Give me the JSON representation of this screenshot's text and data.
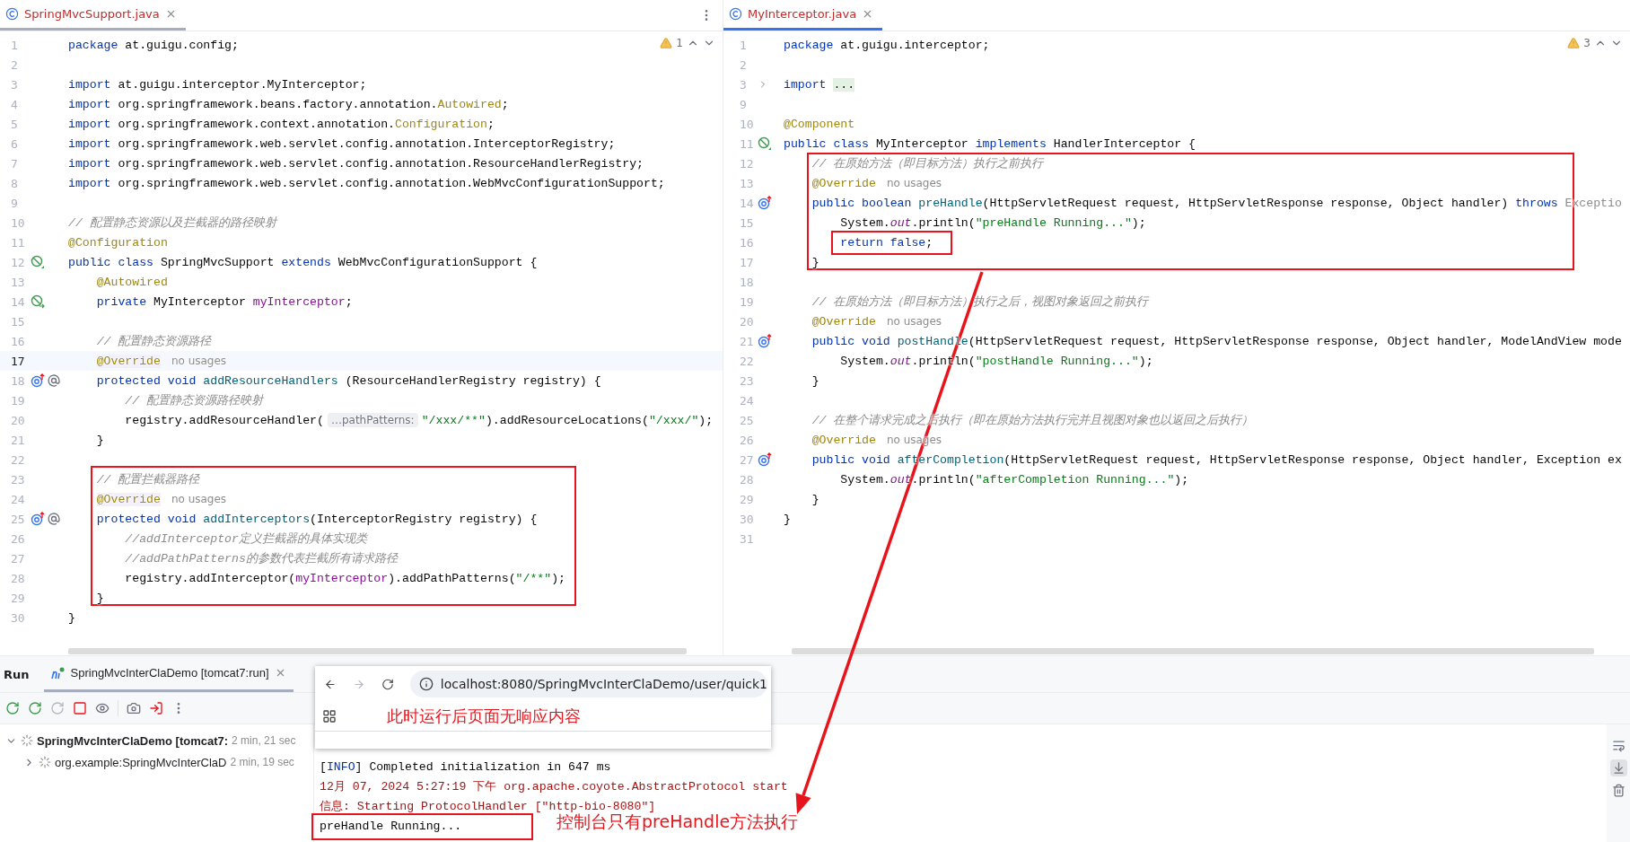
{
  "editors": [
    {
      "tabs": [
        {
          "label": "SpringMvcSupport.java",
          "selected": false
        }
      ],
      "warnings": "1",
      "menu": true,
      "lines": [
        {
          "n": "1",
          "current": false,
          "tokens": [
            {
              "kind": "kw",
              "text": "package"
            },
            {
              "kind": "p",
              "text": " at.guigu.config;"
            }
          ]
        },
        {
          "n": "2",
          "current": false
        },
        {
          "n": "3",
          "current": false,
          "tokens": [
            {
              "kind": "kw",
              "text": "import"
            },
            {
              "kind": "p",
              "text": " at.guigu.interceptor.MyInterceptor;"
            }
          ]
        },
        {
          "n": "4",
          "current": false,
          "tokens": [
            {
              "kind": "kw",
              "text": "import"
            },
            {
              "kind": "p",
              "text": " org.springframework.beans.factory.annotation."
            },
            {
              "kind": "ann",
              "text": "Autowired"
            },
            {
              "kind": "p",
              "text": ";"
            }
          ]
        },
        {
          "n": "5",
          "current": false,
          "tokens": [
            {
              "kind": "kw",
              "text": "import"
            },
            {
              "kind": "p",
              "text": " org.springframework.context.annotation."
            },
            {
              "kind": "ann",
              "text": "Configuration"
            },
            {
              "kind": "p",
              "text": ";"
            }
          ]
        },
        {
          "n": "6",
          "current": false,
          "tokens": [
            {
              "kind": "kw",
              "text": "import"
            },
            {
              "kind": "p",
              "text": " org.springframework.web.servlet.config.annotation.InterceptorRegistry;"
            }
          ]
        },
        {
          "n": "7",
          "current": false,
          "tokens": [
            {
              "kind": "kw",
              "text": "import"
            },
            {
              "kind": "p",
              "text": " org.springframework.web.servlet.config.annotation.ResourceHandlerRegistry;"
            }
          ]
        },
        {
          "n": "8",
          "current": false,
          "tokens": [
            {
              "kind": "kw",
              "text": "import"
            },
            {
              "kind": "p",
              "text": " org.springframework.web.servlet.config.annotation.WebMvcConfigurationSupport;"
            }
          ]
        },
        {
          "n": "9",
          "current": false
        },
        {
          "n": "10",
          "current": false,
          "tokens": [
            {
              "kind": "cm",
              "text": "// 配置静态资源以及拦截器的路径映射"
            }
          ]
        },
        {
          "n": "11",
          "current": false,
          "tokens": [
            {
              "kind": "ann",
              "text": "@Configuration"
            }
          ]
        },
        {
          "n": "12",
          "current": false,
          "gutter": [
            {
              "kind": "bean"
            }
          ],
          "tokens": [
            {
              "kind": "kw",
              "text": "public class"
            },
            {
              "kind": "p",
              "text": " SpringMvcSupport "
            },
            {
              "kind": "kw",
              "text": "extends"
            },
            {
              "kind": "p",
              "text": " WebMvcConfigurationSupport {"
            }
          ]
        },
        {
          "n": "13",
          "current": false,
          "tokens": [
            {
              "kind": "ann",
              "text": "    @Autowired"
            }
          ]
        },
        {
          "n": "14",
          "current": false,
          "gutter": [
            {
              "kind": "bean-link"
            }
          ],
          "tokens": [
            {
              "kind": "kw",
              "text": "    private"
            },
            {
              "kind": "p",
              "text": " MyInterceptor "
            },
            {
              "kind": "fld",
              "text": "myInterceptor"
            },
            {
              "kind": "p",
              "text": ";"
            }
          ]
        },
        {
          "n": "15",
          "current": false
        },
        {
          "n": "16",
          "current": false,
          "tokens": [
            {
              "kind": "cm",
              "text": "    // 配置静态资源路径"
            }
          ]
        },
        {
          "n": "17",
          "current": true,
          "tokens": [
            {
              "kind": "annbg",
              "text": "    @Override"
            },
            {
              "kind": "hint",
              "text": "no usages"
            }
          ]
        },
        {
          "n": "18",
          "current": false,
          "gutter": [
            {
              "kind": "override"
            },
            {
              "kind": "at"
            }
          ],
          "tokens": [
            {
              "kind": "kw",
              "text": "    protected void"
            },
            {
              "kind": "fn",
              "text": " addResourceHandlers"
            },
            {
              "kind": "p",
              "text": " (ResourceHandlerRegistry registry) {"
            }
          ]
        },
        {
          "n": "19",
          "current": false,
          "tokens": [
            {
              "kind": "cm",
              "text": "        // 配置静态资源路径映射"
            }
          ]
        },
        {
          "n": "20",
          "current": false,
          "tokens": [
            {
              "kind": "p",
              "text": "        registry.addResourceHandler("
            },
            {
              "kind": "pill",
              "text": "…pathPatterns:"
            },
            {
              "kind": "str",
              "text": "\"/xxx/**\""
            },
            {
              "kind": "p",
              "text": ").addResourceLocations("
            },
            {
              "kind": "str",
              "text": "\"/xxx/\""
            },
            {
              "kind": "p",
              "text": ");"
            }
          ]
        },
        {
          "n": "21",
          "current": false,
          "tokens": [
            {
              "kind": "p",
              "text": "    }"
            }
          ]
        },
        {
          "n": "22",
          "current": false
        },
        {
          "n": "23",
          "current": false,
          "tokens": [
            {
              "kind": "cm",
              "text": "    // 配置拦截器路径"
            }
          ]
        },
        {
          "n": "24",
          "current": false,
          "tokens": [
            {
              "kind": "annbg",
              "text": "    @Override"
            },
            {
              "kind": "hint",
              "text": "no usages"
            }
          ]
        },
        {
          "n": "25",
          "current": false,
          "gutter": [
            {
              "kind": "override"
            },
            {
              "kind": "at"
            }
          ],
          "tokens": [
            {
              "kind": "kw",
              "text": "    protected void"
            },
            {
              "kind": "fn",
              "text": " addInterceptors"
            },
            {
              "kind": "p",
              "text": "(InterceptorRegistry registry) {"
            }
          ]
        },
        {
          "n": "26",
          "current": false,
          "tokens": [
            {
              "kind": "cm",
              "text": "        //addInterceptor定义拦截器的具体实现类"
            }
          ]
        },
        {
          "n": "27",
          "current": false,
          "tokens": [
            {
              "kind": "cm",
              "text": "        //addPathPatterns的参数代表拦截所有请求路径"
            }
          ]
        },
        {
          "n": "28",
          "current": false,
          "tokens": [
            {
              "kind": "p",
              "text": "        registry.addInterceptor("
            },
            {
              "kind": "fld",
              "text": "myInterceptor"
            },
            {
              "kind": "p",
              "text": ").addPathPatterns("
            },
            {
              "kind": "str",
              "text": "\"/**\""
            },
            {
              "kind": "p",
              "text": ");"
            }
          ]
        },
        {
          "n": "29",
          "current": false,
          "tokens": [
            {
              "kind": "p",
              "text": "    }"
            }
          ]
        },
        {
          "n": "30",
          "current": false,
          "tokens": [
            {
              "kind": "p",
              "text": "}"
            }
          ]
        }
      ]
    },
    {
      "tabs": [
        {
          "label": "MyInterceptor.java",
          "selected": true
        }
      ],
      "warnings": "3",
      "menu": false,
      "lines": [
        {
          "n": "1",
          "current": false,
          "tokens": [
            {
              "kind": "kw",
              "text": "package"
            },
            {
              "kind": "p",
              "text": " at.guigu.interceptor;"
            }
          ]
        },
        {
          "n": "2",
          "current": false
        },
        {
          "n": "3",
          "current": false,
          "gutter": [
            {
              "kind": "fold"
            }
          ],
          "tokens": [
            {
              "kind": "kw",
              "text": "import "
            },
            {
              "kind": "fold",
              "text": "..."
            }
          ]
        },
        {
          "n": "9",
          "current": false
        },
        {
          "n": "10",
          "current": false,
          "tokens": [
            {
              "kind": "ann",
              "text": "@Component"
            }
          ]
        },
        {
          "n": "11",
          "current": false,
          "gutter": [
            {
              "kind": "bean"
            }
          ],
          "tokens": [
            {
              "kind": "kw",
              "text": "public class"
            },
            {
              "kind": "p",
              "text": " MyInterceptor "
            },
            {
              "kind": "kw",
              "text": "implements"
            },
            {
              "kind": "p",
              "text": " HandlerInterceptor {"
            }
          ]
        },
        {
          "n": "12",
          "current": false,
          "tokens": [
            {
              "kind": "cm",
              "text": "    // 在原始方法（即目标方法）执行之前执行"
            }
          ]
        },
        {
          "n": "13",
          "current": false,
          "tokens": [
            {
              "kind": "ann",
              "text": "    @Override"
            },
            {
              "kind": "hint",
              "text": "no usages"
            }
          ]
        },
        {
          "n": "14",
          "current": false,
          "gutter": [
            {
              "kind": "override"
            }
          ],
          "tokens": [
            {
              "kind": "kw",
              "text": "    public boolean"
            },
            {
              "kind": "fn",
              "text": " preHandle"
            },
            {
              "kind": "p",
              "text": "(HttpServletRequest request, HttpServletResponse response, Object handler) "
            },
            {
              "kind": "kw",
              "text": "throws"
            },
            {
              "kind": "dim",
              "text": " Exceptio"
            }
          ]
        },
        {
          "n": "15",
          "current": false,
          "tokens": [
            {
              "kind": "p",
              "text": "        System."
            },
            {
              "kind": "st",
              "text": "out"
            },
            {
              "kind": "p",
              "text": ".println("
            },
            {
              "kind": "str",
              "text": "\"preHandle Running...\""
            },
            {
              "kind": "p",
              "text": ");"
            }
          ]
        },
        {
          "n": "16",
          "current": false,
          "tokens": [
            {
              "kind": "kw",
              "text": "        return false"
            },
            {
              "kind": "p",
              "text": ";"
            }
          ]
        },
        {
          "n": "17",
          "current": false,
          "tokens": [
            {
              "kind": "p",
              "text": "    }"
            }
          ]
        },
        {
          "n": "18",
          "current": false
        },
        {
          "n": "19",
          "current": false,
          "tokens": [
            {
              "kind": "cm",
              "text": "    // 在原始方法（即目标方法）执行之后，视图对象返回之前执行"
            }
          ]
        },
        {
          "n": "20",
          "current": false,
          "tokens": [
            {
              "kind": "ann",
              "text": "    @Override"
            },
            {
              "kind": "hint",
              "text": "no usages"
            }
          ]
        },
        {
          "n": "21",
          "current": false,
          "gutter": [
            {
              "kind": "override"
            }
          ],
          "tokens": [
            {
              "kind": "kw",
              "text": "    public void"
            },
            {
              "kind": "fn",
              "text": " postHandle"
            },
            {
              "kind": "p",
              "text": "(HttpServletRequest request, HttpServletResponse response, Object handler, ModelAndView mode"
            }
          ]
        },
        {
          "n": "22",
          "current": false,
          "tokens": [
            {
              "kind": "p",
              "text": "        System."
            },
            {
              "kind": "st",
              "text": "out"
            },
            {
              "kind": "p",
              "text": ".println("
            },
            {
              "kind": "str",
              "text": "\"postHandle Running...\""
            },
            {
              "kind": "p",
              "text": ");"
            }
          ]
        },
        {
          "n": "23",
          "current": false,
          "tokens": [
            {
              "kind": "p",
              "text": "    }"
            }
          ]
        },
        {
          "n": "24",
          "current": false
        },
        {
          "n": "25",
          "current": false,
          "tokens": [
            {
              "kind": "cm",
              "text": "    // 在整个请求完成之后执行（即在原始方法执行完并且视图对象也以返回之后执行）"
            }
          ]
        },
        {
          "n": "26",
          "current": false,
          "tokens": [
            {
              "kind": "ann",
              "text": "    @Override"
            },
            {
              "kind": "hint",
              "text": "no usages"
            }
          ]
        },
        {
          "n": "27",
          "current": false,
          "gutter": [
            {
              "kind": "override"
            }
          ],
          "tokens": [
            {
              "kind": "kw",
              "text": "    public void"
            },
            {
              "kind": "fn",
              "text": " afterCompletion"
            },
            {
              "kind": "p",
              "text": "(HttpServletRequest request, HttpServletResponse response, Object handler, Exception ex"
            }
          ]
        },
        {
          "n": "28",
          "current": false,
          "tokens": [
            {
              "kind": "p",
              "text": "        System."
            },
            {
              "kind": "st",
              "text": "out"
            },
            {
              "kind": "p",
              "text": ".println("
            },
            {
              "kind": "str",
              "text": "\"afterCompletion Running...\""
            },
            {
              "kind": "p",
              "text": ");"
            }
          ]
        },
        {
          "n": "29",
          "current": false,
          "tokens": [
            {
              "kind": "p",
              "text": "    }"
            }
          ]
        },
        {
          "n": "30",
          "current": false,
          "tokens": [
            {
              "kind": "p",
              "text": "}"
            }
          ]
        },
        {
          "n": "31",
          "current": false
        }
      ]
    }
  ],
  "run_panel": {
    "title": "Run",
    "tabs": [
      {
        "label": "SpringMvcInterClaDemo [tomcat7:run]",
        "selected": true
      }
    ],
    "toolbar": [
      {
        "kind": "rerun",
        "disabled": false
      },
      {
        "kind": "rerun-tests",
        "disabled": false
      },
      {
        "kind": "restart",
        "disabled": true
      },
      {
        "kind": "stop",
        "disabled": false
      },
      {
        "kind": "watch",
        "disabled": false
      },
      {
        "kind": "screenshot",
        "disabled": false
      },
      {
        "kind": "exit",
        "disabled": false
      },
      {
        "kind": "more",
        "disabled": false
      }
    ],
    "tree": [
      {
        "label": "SpringMvcInterClaDemo [tomcat7:",
        "time": "2 min, 21 sec",
        "expanded": true,
        "children": [
          {
            "label": "org.example:SpringMvcInterClaD",
            "time": "2 min, 19 sec",
            "expanded": false
          }
        ]
      }
    ],
    "console": [
      {
        "tokens": [
          {
            "kind": "p",
            "text": "["
          },
          {
            "kind": "info",
            "text": "INFO"
          },
          {
            "kind": "p",
            "text": "] Completed initialization in 647 ms"
          }
        ]
      },
      {
        "tokens": [
          {
            "kind": "err",
            "text": "12月 07, 2024 5:27:19 下午 org.apache.coyote.AbstractProtocol start"
          }
        ]
      },
      {
        "tokens": [
          {
            "kind": "err",
            "text": "信息: Starting ProtocolHandler [\"http-bio-8080\"]"
          }
        ]
      },
      {
        "tokens": [
          {
            "kind": "p",
            "text": "preHandle Running..."
          }
        ]
      }
    ],
    "side_tools": [
      {
        "kind": "wrap",
        "selected": false
      },
      {
        "kind": "scroll-end",
        "selected": true
      },
      {
        "kind": "trash",
        "selected": false
      }
    ]
  },
  "browser_popup": {
    "nav": [
      {
        "kind": "back",
        "disabled": false
      },
      {
        "kind": "forward",
        "disabled": true
      },
      {
        "kind": "reload",
        "disabled": false
      }
    ],
    "url": "localhost:8080/SpringMvcInterClaDemo/user/quick1",
    "note": "此时运行后页面无响应内容"
  },
  "annotations": {
    "console_note": "控制台只有preHandle方法执行"
  }
}
